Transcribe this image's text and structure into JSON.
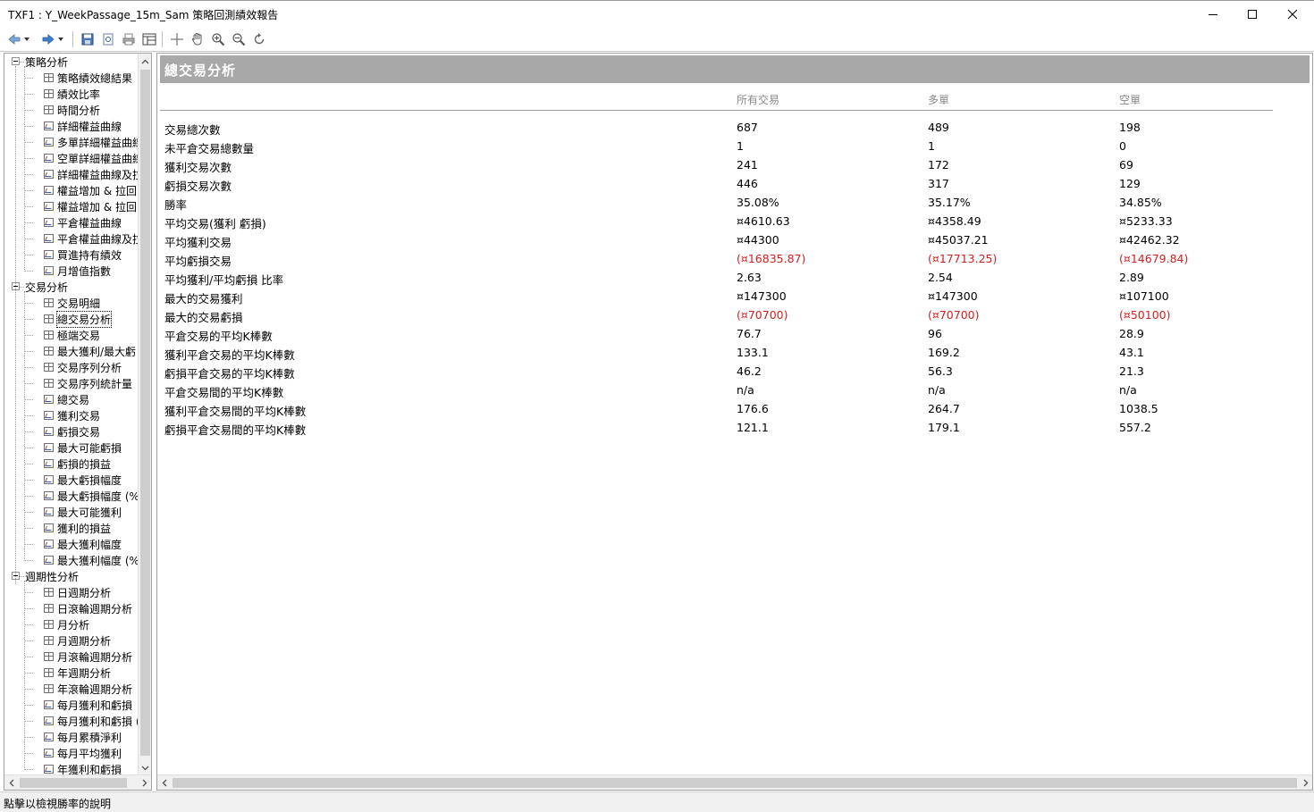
{
  "window": {
    "title": "TXF1 : Y_WeekPassage_15m_Sam 策略回測績效報告"
  },
  "toolbar": {
    "buttons": [
      "back-icon",
      "back-dropdown-icon",
      "forward-icon",
      "forward-dropdown-icon",
      "save-icon",
      "print-preview-icon",
      "print-icon",
      "table-view-icon",
      "crosshair-icon",
      "hand-icon",
      "zoom-in-icon",
      "zoom-out-icon",
      "refresh-icon"
    ]
  },
  "tree": {
    "groups": [
      {
        "label": "策略分析",
        "items": [
          {
            "label": "策略績效總結果",
            "icon": "grid"
          },
          {
            "label": "績效比率",
            "icon": "grid"
          },
          {
            "label": "時間分析",
            "icon": "grid"
          },
          {
            "label": "詳細權益曲線",
            "icon": "chart"
          },
          {
            "label": "多單詳細權益曲線",
            "icon": "chart"
          },
          {
            "label": "空單詳細權益曲線",
            "icon": "chart"
          },
          {
            "label": "詳細權益曲線及拉",
            "icon": "chart"
          },
          {
            "label": "權益增加 & 拉回",
            "icon": "chart"
          },
          {
            "label": "權益增加 & 拉回(",
            "icon": "chart"
          },
          {
            "label": "平倉權益曲線",
            "icon": "chart"
          },
          {
            "label": "平倉權益曲線及拉",
            "icon": "chart"
          },
          {
            "label": "買進持有績效",
            "icon": "chart"
          },
          {
            "label": "月增值指數",
            "icon": "chart"
          }
        ]
      },
      {
        "label": "交易分析",
        "items": [
          {
            "label": "交易明細",
            "icon": "grid"
          },
          {
            "label": "總交易分析",
            "icon": "grid",
            "selected": true
          },
          {
            "label": "極端交易",
            "icon": "grid"
          },
          {
            "label": "最大獲利/最大虧",
            "icon": "grid"
          },
          {
            "label": "交易序列分析",
            "icon": "grid"
          },
          {
            "label": "交易序列統計量",
            "icon": "grid"
          },
          {
            "label": "總交易",
            "icon": "chart"
          },
          {
            "label": "獲利交易",
            "icon": "chart"
          },
          {
            "label": "虧損交易",
            "icon": "chart"
          },
          {
            "label": "最大可能虧損",
            "icon": "chart"
          },
          {
            "label": "虧損的損益",
            "icon": "chart"
          },
          {
            "label": "最大虧損幅度",
            "icon": "chart"
          },
          {
            "label": "最大虧損幅度 (%",
            "icon": "chart"
          },
          {
            "label": "最大可能獲利",
            "icon": "chart"
          },
          {
            "label": "獲利的損益",
            "icon": "chart"
          },
          {
            "label": "最大獲利幅度",
            "icon": "chart"
          },
          {
            "label": "最大獲利幅度 (%",
            "icon": "chart"
          }
        ]
      },
      {
        "label": "週期性分析",
        "items": [
          {
            "label": "日週期分析",
            "icon": "grid"
          },
          {
            "label": "日滾輪週期分析",
            "icon": "grid"
          },
          {
            "label": "月分析",
            "icon": "grid"
          },
          {
            "label": "月週期分析",
            "icon": "grid"
          },
          {
            "label": "月滾輪週期分析",
            "icon": "grid"
          },
          {
            "label": "年週期分析",
            "icon": "grid"
          },
          {
            "label": "年滾輪週期分析",
            "icon": "grid"
          },
          {
            "label": "每月獲利和虧損",
            "icon": "chart"
          },
          {
            "label": "每月獲利和虧損 (",
            "icon": "chart"
          },
          {
            "label": "每月累積淨利",
            "icon": "chart"
          },
          {
            "label": "每月平均獲利",
            "icon": "chart"
          },
          {
            "label": "年獲利和虧損",
            "icon": "chart"
          }
        ]
      }
    ]
  },
  "report": {
    "title": "總交易分析",
    "columns": [
      "所有交易",
      "多單",
      "空單"
    ],
    "rows": [
      {
        "label": "交易總次數",
        "values": [
          "687",
          "489",
          "198"
        ],
        "neg": false
      },
      {
        "label": "未平倉交易總數量",
        "values": [
          "1",
          "1",
          "0"
        ],
        "neg": false
      },
      {
        "label": "獲利交易次數",
        "values": [
          "241",
          "172",
          "69"
        ],
        "neg": false
      },
      {
        "label": "虧損交易次數",
        "values": [
          "446",
          "317",
          "129"
        ],
        "neg": false
      },
      {
        "label": "勝率",
        "values": [
          "35.08%",
          "35.17%",
          "34.85%"
        ],
        "neg": false
      },
      {
        "label": "平均交易(獲利 虧損)",
        "values": [
          "¤4610.63",
          "¤4358.49",
          "¤5233.33"
        ],
        "neg": false
      },
      {
        "label": "平均獲利交易",
        "values": [
          "¤44300",
          "¤45037.21",
          "¤42462.32"
        ],
        "neg": false
      },
      {
        "label": "平均虧損交易",
        "values": [
          "(¤16835.87)",
          "(¤17713.25)",
          "(¤14679.84)"
        ],
        "neg": true
      },
      {
        "label": "平均獲利/平均虧損 比率",
        "values": [
          "2.63",
          "2.54",
          "2.89"
        ],
        "neg": false
      },
      {
        "label": "最大的交易獲利",
        "values": [
          "¤147300",
          "¤147300",
          "¤107100"
        ],
        "neg": false
      },
      {
        "label": "最大的交易虧損",
        "values": [
          "(¤70700)",
          "(¤70700)",
          "(¤50100)"
        ],
        "neg": true
      },
      {
        "label": "平倉交易的平均K棒數",
        "values": [
          "76.7",
          "96",
          "28.9"
        ],
        "neg": false
      },
      {
        "label": "獲利平倉交易的平均K棒數",
        "values": [
          "133.1",
          "169.2",
          "43.1"
        ],
        "neg": false
      },
      {
        "label": "虧損平倉交易的平均K棒數",
        "values": [
          "46.2",
          "56.3",
          "21.3"
        ],
        "neg": false
      },
      {
        "label": "平倉交易間的平均K棒數",
        "values": [
          "n/a",
          "n/a",
          "n/a"
        ],
        "neg": false
      },
      {
        "label": "獲利平倉交易間的平均K棒數",
        "values": [
          "176.6",
          "264.7",
          "1038.5"
        ],
        "neg": false
      },
      {
        "label": "虧損平倉交易間的平均K棒數",
        "values": [
          "121.1",
          "179.1",
          "557.2"
        ],
        "neg": false
      }
    ]
  },
  "status": {
    "text": "點擊以檢視勝率的說明"
  },
  "colors": {
    "negative": "#d02020",
    "header_bg": "#a8a8a8",
    "column_header": "#8a8a8a"
  }
}
